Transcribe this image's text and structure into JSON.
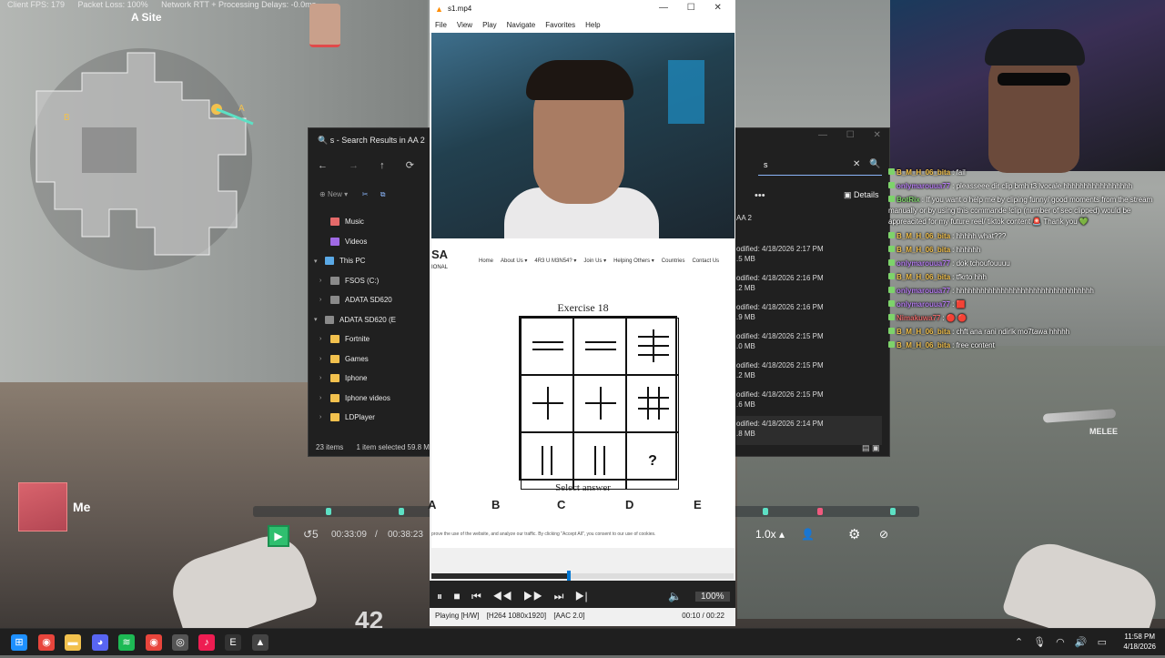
{
  "game": {
    "stats": [
      "Client FPS: 179",
      "Packet Loss: 100%",
      "Network RTT + Processing Delays: -0.0ms"
    ],
    "site": "A Site",
    "player_label": "Me",
    "ammo": "42",
    "weapon_slot": "MELEE",
    "clip_overlay": {
      "elapsed": "00:33:09",
      "separator": "/",
      "total": "00:38:23",
      "speed": "1.0x"
    }
  },
  "explorer": {
    "title": "s - Search Results in AA 2",
    "new_label": "New",
    "tree": [
      {
        "label": "Music",
        "indent": 1,
        "chev": "",
        "color": "#e56a6a"
      },
      {
        "label": "Videos",
        "indent": 1,
        "chev": "",
        "color": "#a06ae5"
      },
      {
        "label": "This PC",
        "indent": 0,
        "chev": "▾",
        "color": "#5aa9e6"
      },
      {
        "label": "FSOS (C:)",
        "indent": 1,
        "chev": "›",
        "color": "#8a8a8a"
      },
      {
        "label": "ADATA SD620",
        "indent": 1,
        "chev": "›",
        "color": "#8a8a8a"
      },
      {
        "label": "ADATA SD620 (E",
        "indent": 0,
        "chev": "▾",
        "color": "#8a8a8a"
      },
      {
        "label": "Fortnite",
        "indent": 1,
        "chev": "›",
        "color": "#f2c14e"
      },
      {
        "label": "Games",
        "indent": 1,
        "chev": "›",
        "color": "#f2c14e"
      },
      {
        "label": "Iphone",
        "indent": 1,
        "chev": "›",
        "color": "#f2c14e"
      },
      {
        "label": "Iphone videos",
        "indent": 1,
        "chev": "›",
        "color": "#f2c14e"
      },
      {
        "label": "LDPlayer",
        "indent": 1,
        "chev": "›",
        "color": "#f2c14e"
      }
    ],
    "status": [
      "23 items",
      "1 item selected  59.8 M"
    ],
    "search_value": "s",
    "details_label": "Details",
    "crumb": "AA 2",
    "files": [
      {
        "modified": "odified: 4/18/2026 2:17 PM",
        "size": ".5 MB"
      },
      {
        "modified": "odified: 4/18/2026 2:16 PM",
        "size": ".2 MB"
      },
      {
        "modified": "odified: 4/18/2026 2:16 PM",
        "size": ".9 MB"
      },
      {
        "modified": "odified: 4/18/2026 2:15 PM",
        "size": ".0 MB"
      },
      {
        "modified": "odified: 4/18/2026 2:15 PM",
        "size": ".2 MB"
      },
      {
        "modified": "odified: 4/18/2026 2:15 PM",
        "size": ".6 MB"
      },
      {
        "modified": "odified: 4/18/2026 2:14 PM",
        "size": ".8 MB"
      }
    ]
  },
  "vlc": {
    "title": "s1.mp4",
    "menu": [
      "File",
      "View",
      "Play",
      "Navigate",
      "Favorites",
      "Help"
    ],
    "web": {
      "logo": "SA",
      "logo_sub": "IONAL",
      "nav": [
        "Home",
        "About Us ▾",
        "4R3 U M3N54? ▾",
        "Join Us ▾",
        "Helping Others ▾",
        "Countries",
        "Contact Us"
      ],
      "heading": "Exercise 18",
      "question_mark": "?",
      "select_label": "Select answer",
      "options": [
        "A",
        "B",
        "C",
        "D",
        "E"
      ],
      "cookie": "prove the use of the website, and analyze our traffic. By clicking \"Accept All\", you consent to our use of cookies."
    },
    "progress": 0.4545,
    "volume": "100%",
    "status": [
      "Playing [H/W]",
      "[H264 1080x1920]",
      "[AAC 2.0]"
    ],
    "time": "00:10 / 00:22"
  },
  "chat": [
    {
      "user": "B_M_H_06_bita",
      "text": ": fail",
      "color": "#f2c14e"
    },
    {
      "user": "onlymarouua77",
      "text": ": pleasseee dir clip bmh t3 lvocale hhhhhhhhhhhhhhhhh",
      "color": "#b57cf0"
    },
    {
      "user": "BotRix",
      "text": ": If you want o help me by cliping funny/ good moments from the stream manually or by using this commande !clip (number of sec clipped) would be appreacited for my future reel/ tiktok content 🚨 Thank you 💚",
      "color": "#7dd36b",
      "wrap": true
    },
    {
      "user": "B_M_H_06_bita",
      "text": ": hhhhh what???",
      "color": "#f2c14e"
    },
    {
      "user": "B_M_H_06_bita",
      "text": ": hhhhhh",
      "color": "#f2c14e"
    },
    {
      "user": "onlymarouua77",
      "text": ": dok tchoufouuuu",
      "color": "#b57cf0"
    },
    {
      "user": "B_M_H_06_bita",
      "text": ": tfkrto hhh",
      "color": "#f2c14e"
    },
    {
      "user": "onlymarouua77",
      "text": ": hhhhhhhhhhhhhhhhhhhhhhhhhhhhhhhhhh",
      "color": "#b57cf0"
    },
    {
      "user": "onlymarouua77",
      "text": ": 🟥",
      "color": "#b57cf0"
    },
    {
      "user": "Nimakuwa77",
      "text": ": 🔴 🔴",
      "color": "#e56a6a"
    },
    {
      "user": "B_M_H_06_bita",
      "text": ": chft ana rani ndirlk mo7tawa hhhhh",
      "color": "#f2c14e"
    },
    {
      "user": "B_M_H_06_bita",
      "text": ": free content",
      "color": "#f2c14e"
    }
  ],
  "taskbar": {
    "icons": [
      {
        "name": "windows-start-icon",
        "glyph": "⊞",
        "color": "#1e90ff"
      },
      {
        "name": "chrome-icon",
        "glyph": "◉",
        "color": "#e8453c"
      },
      {
        "name": "file-explorer-icon",
        "glyph": "▬",
        "color": "#f2c14e"
      },
      {
        "name": "discord-icon",
        "glyph": "◕",
        "color": "#5865f2"
      },
      {
        "name": "spotify-icon",
        "glyph": "≋",
        "color": "#1db954"
      },
      {
        "name": "chrome-alt-icon",
        "glyph": "◉",
        "color": "#e8453c"
      },
      {
        "name": "obs-icon",
        "glyph": "◎",
        "color": "#555555"
      },
      {
        "name": "tiktok-icon",
        "glyph": "♪",
        "color": "#ee1d52"
      },
      {
        "name": "epic-icon",
        "glyph": "E",
        "color": "#333333"
      },
      {
        "name": "vlc-taskbar-icon",
        "glyph": "▲",
        "color": "#444444"
      }
    ],
    "time": "11:58 PM",
    "date": "4/18/2026"
  }
}
